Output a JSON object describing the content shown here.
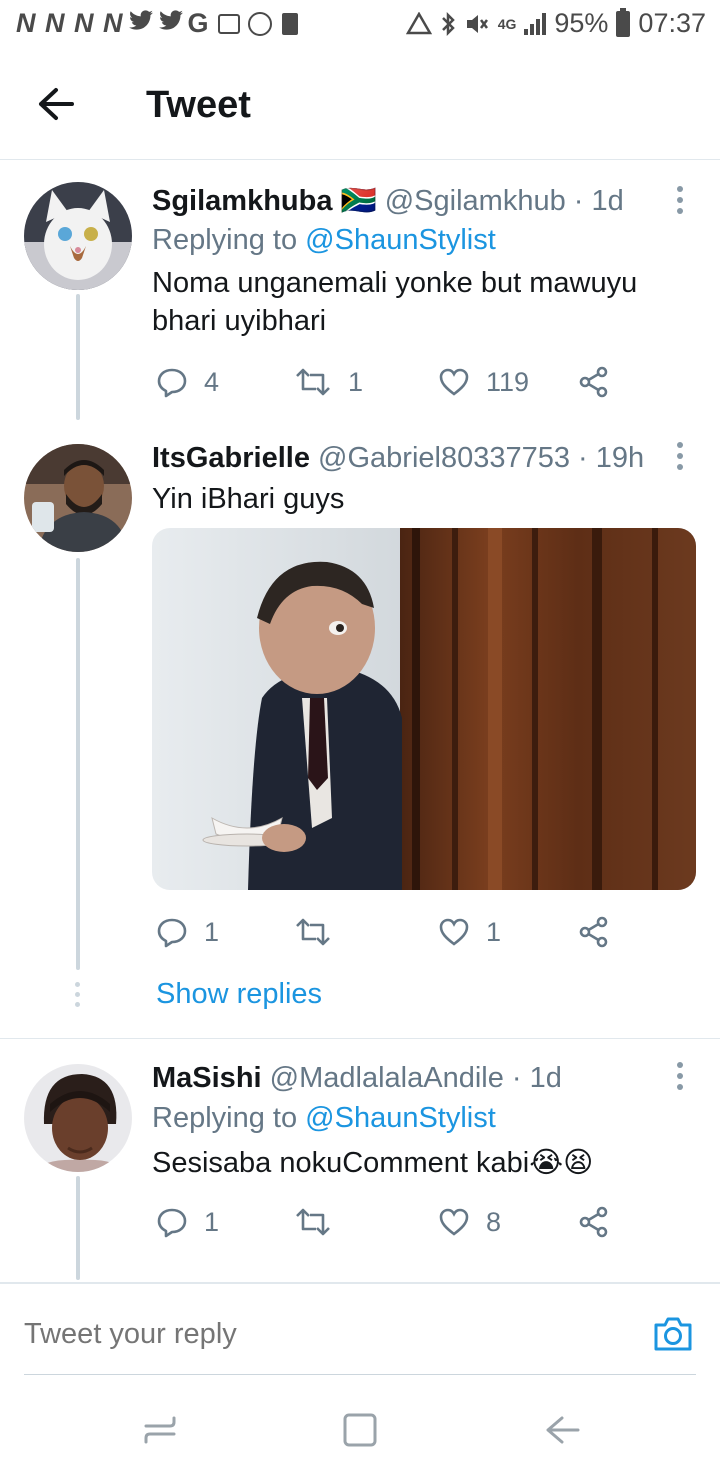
{
  "status_bar": {
    "left_glyphs": "N N N N",
    "battery": "95%",
    "time": "07:37",
    "network": "4G"
  },
  "header": {
    "title": "Tweet"
  },
  "tweets": [
    {
      "name": "Sgilamkhuba",
      "flag": "🇿🇦",
      "handle": "@Sgilamkhub",
      "time": "· 1d",
      "replying_label": "Replying to",
      "replying_to": "@ShaunStylist",
      "text": "Noma unganemali yonke but mawuyu bhari uyibhari",
      "replies": "4",
      "retweets": "1",
      "likes": "119"
    },
    {
      "name": "ItsGabrielle",
      "handle": "@Gabriel80337753",
      "time": "· 19h",
      "text": "Yin iBhari guys",
      "replies": "1",
      "retweets": "",
      "likes": "1",
      "show_replies": "Show replies"
    },
    {
      "name": "MaSishi",
      "handle": "@MadlalalaAndile",
      "time": "· 1d",
      "replying_label": "Replying to",
      "replying_to": "@ShaunStylist",
      "text": "Sesisaba nokuComment kabi😭😫",
      "replies": "1",
      "retweets": "",
      "likes": "8"
    }
  ],
  "composer": {
    "placeholder": "Tweet your reply"
  },
  "colors": {
    "link_blue": "#1b95e0",
    "muted_gray": "#657786",
    "text_dark": "#14171a",
    "thread_line": "#ccd6dd"
  }
}
